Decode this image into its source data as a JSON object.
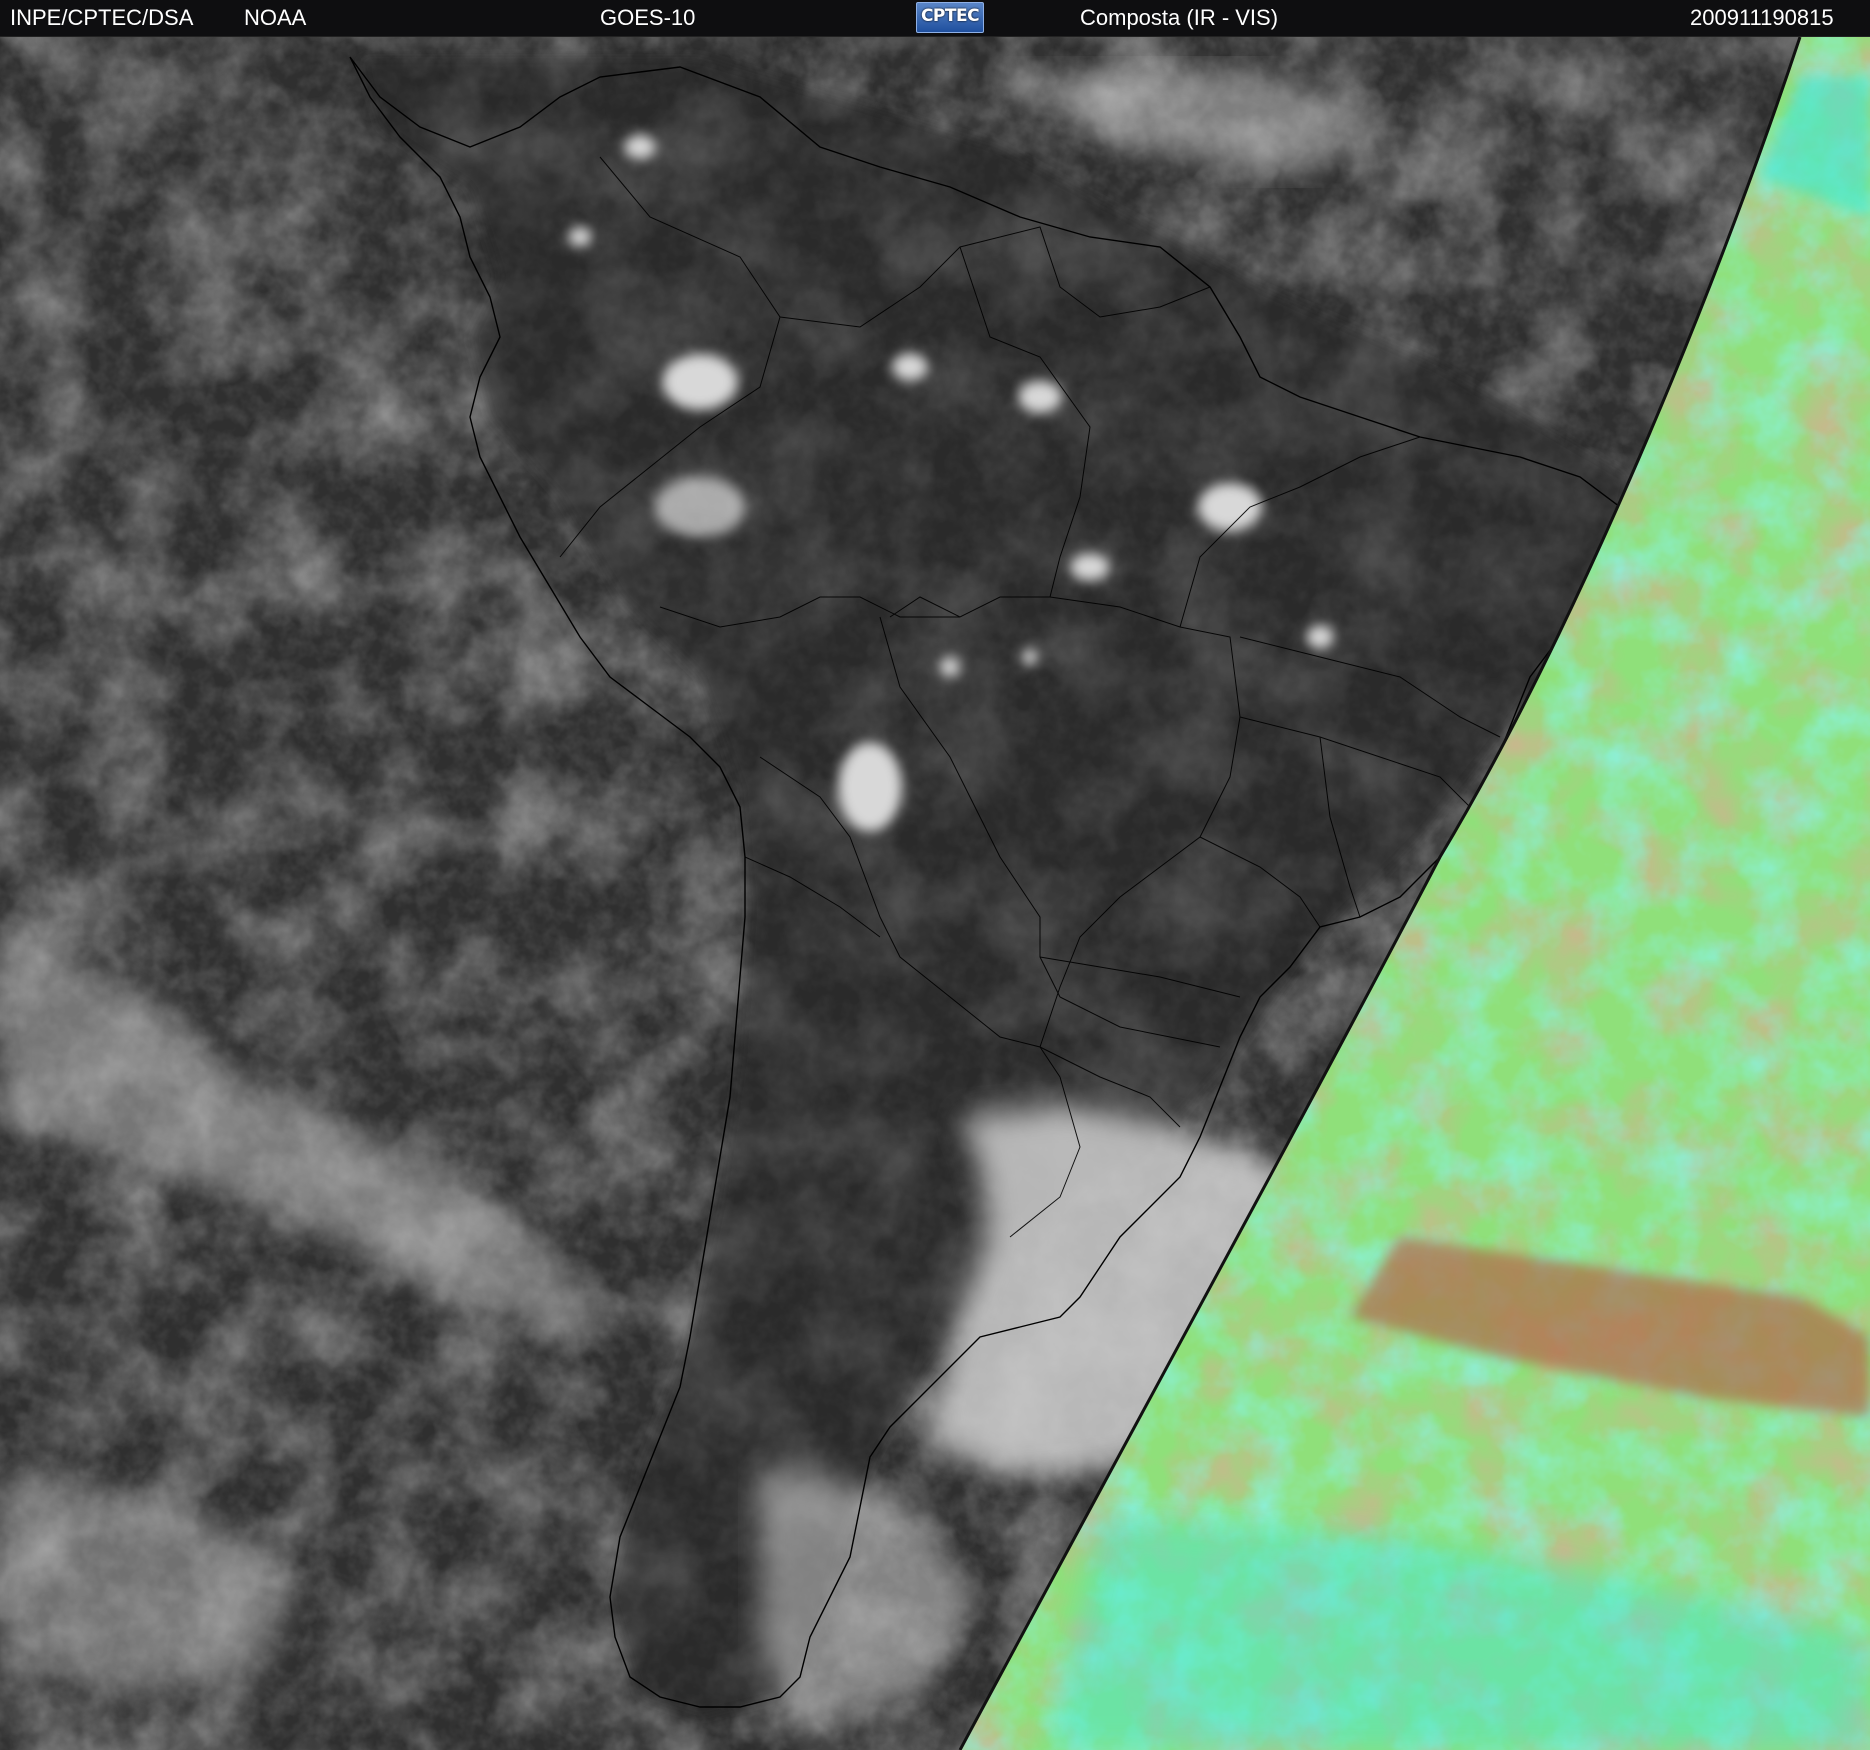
{
  "header": {
    "institution": "INPE/CPTEC/DSA",
    "agency": "NOAA",
    "satellite": "GOES-10",
    "logo_text": "CPTEC",
    "product": "Composta (IR - VIS)",
    "timestamp": "200911190815"
  },
  "imagery": {
    "region": "South America",
    "ir_palette": "grayscale",
    "vis_palette": [
      "#8fe07a",
      "#b06a4a",
      "#3fe8d8",
      "#c9d84a"
    ]
  },
  "colors": {
    "header_bg": "#0e0e10",
    "header_text": "#ffffff",
    "ocean_ir": "#3a3a3a"
  }
}
